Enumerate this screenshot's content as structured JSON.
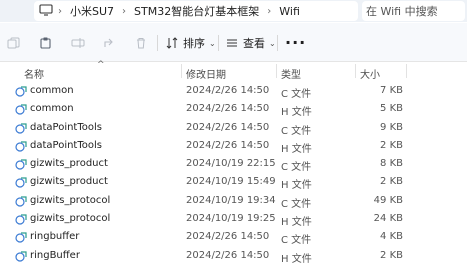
{
  "breadcrumb": [
    "小米SU7",
    "STM32智能台灯基本框架",
    "Wifi"
  ],
  "search": {
    "placeholder": "在 Wifi 中搜索"
  },
  "toolbar": {
    "sort_label": "排序",
    "view_label": "查看"
  },
  "columns": {
    "name": "名称",
    "modified": "修改日期",
    "type": "类型",
    "size": "大小"
  },
  "files": [
    {
      "name": "common",
      "modified": "2024/2/26 14:50",
      "type": "C 文件",
      "size": "7 KB"
    },
    {
      "name": "common",
      "modified": "2024/2/26 14:50",
      "type": "H 文件",
      "size": "5 KB"
    },
    {
      "name": "dataPointTools",
      "modified": "2024/2/26 14:50",
      "type": "C 文件",
      "size": "9 KB"
    },
    {
      "name": "dataPointTools",
      "modified": "2024/2/26 14:50",
      "type": "H 文件",
      "size": "2 KB"
    },
    {
      "name": "gizwits_product",
      "modified": "2024/10/19 22:15",
      "type": "C 文件",
      "size": "8 KB"
    },
    {
      "name": "gizwits_product",
      "modified": "2024/10/19 15:49",
      "type": "H 文件",
      "size": "2 KB"
    },
    {
      "name": "gizwits_protocol",
      "modified": "2024/10/19 19:34",
      "type": "C 文件",
      "size": "49 KB"
    },
    {
      "name": "gizwits_protocol",
      "modified": "2024/10/19 19:25",
      "type": "H 文件",
      "size": "24 KB"
    },
    {
      "name": "ringbuffer",
      "modified": "2024/2/26 14:50",
      "type": "C 文件",
      "size": "4 KB"
    },
    {
      "name": "ringBuffer",
      "modified": "2024/2/26 14:50",
      "type": "H 文件",
      "size": "2 KB"
    }
  ]
}
